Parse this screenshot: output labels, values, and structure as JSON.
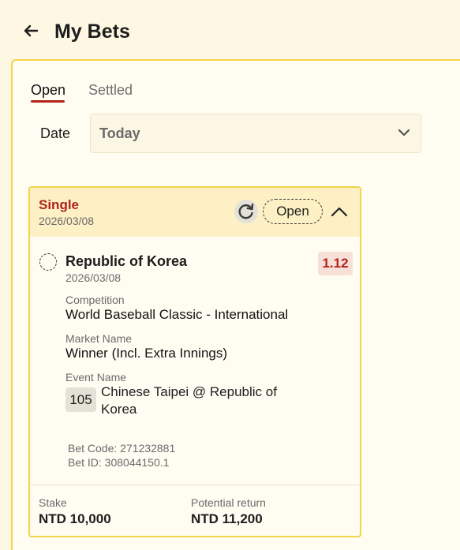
{
  "header": {
    "back_icon": "arrow-left-icon",
    "title": "My Bets"
  },
  "tabs": [
    {
      "label": "Open",
      "active": true
    },
    {
      "label": "Settled",
      "active": false
    }
  ],
  "filter": {
    "label": "Date",
    "selected": "Today",
    "icon": "chevron-down-icon"
  },
  "bet": {
    "type": "Single",
    "date": "2026/03/08",
    "status": "Open",
    "refresh_icon": "refresh-icon",
    "collapse_icon": "chevron-up-icon",
    "selection": "Republic of Korea",
    "selection_date": "2026/03/08",
    "odds": "1.12",
    "competition_label": "Competition",
    "competition": "World Baseball Classic - International",
    "market_label": "Market Name",
    "market": "Winner (Incl. Extra Innings)",
    "event_label": "Event Name",
    "event_number": "105",
    "event_name": "Chinese Taipei @ Republic of Korea",
    "bet_code": "Bet Code: 271232881",
    "bet_id": "Bet ID: 308044150.1",
    "stake_label": "Stake",
    "stake": "NTD 10,000",
    "return_label": "Potential return",
    "potential_return": "NTD 11,200"
  },
  "colors": {
    "accent": "#b3231a",
    "border": "#f2d54a",
    "background": "#fdf7e3"
  }
}
